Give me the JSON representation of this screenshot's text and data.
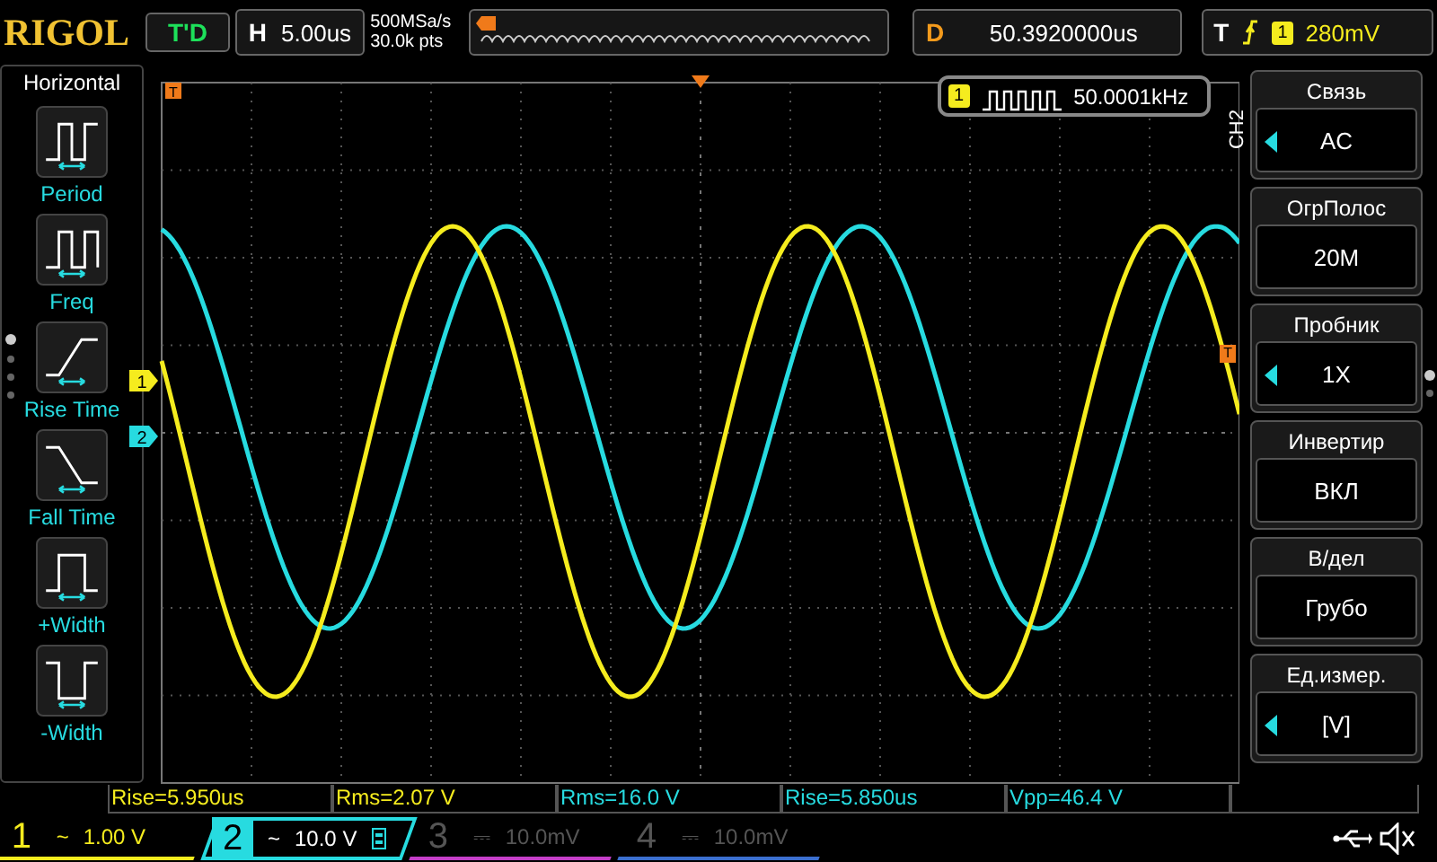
{
  "top_bar": {
    "logo": "RIGOL",
    "run_status": "T'D",
    "horizontal": {
      "label": "H",
      "value": "5.00us"
    },
    "sample_rate": "500MSa/s",
    "memory_depth": "30.0k pts",
    "delay": {
      "label": "D",
      "value": "50.3920000us"
    },
    "trigger": {
      "label": "T",
      "source": "1",
      "level": "280mV"
    }
  },
  "left_menu": {
    "title": "Horizontal",
    "items": [
      {
        "kind": "period",
        "label": "Period"
      },
      {
        "kind": "freq",
        "label": "Freq"
      },
      {
        "kind": "rise",
        "label": "Rise Time"
      },
      {
        "kind": "fall",
        "label": "Fall Time"
      },
      {
        "kind": "pwidth",
        "label": "+Width"
      },
      {
        "kind": "nwidth",
        "label": "-Width"
      }
    ]
  },
  "scope": {
    "counter": {
      "source": "1",
      "value": "50.0001kHz"
    },
    "top_marker": "T",
    "trigger_marker": "T",
    "markers": [
      {
        "label": "1",
        "color": "#f5ec1e"
      },
      {
        "label": "2",
        "color": "#27dbe0"
      }
    ]
  },
  "right_menu": {
    "channel": "CH2",
    "items": [
      {
        "title": "Связь",
        "value": "AC",
        "kind": "list"
      },
      {
        "title": "ОгрПолос",
        "value": "20M",
        "kind": "toggle"
      },
      {
        "title": "Пробник",
        "value": "1X",
        "kind": "list"
      },
      {
        "title": "Инвертир",
        "value": "ВКЛ",
        "kind": "toggle"
      },
      {
        "title": "В/дел",
        "value": "Грубо",
        "kind": "toggle"
      },
      {
        "title": "Ед.измер.",
        "value": "[V]",
        "kind": "list"
      }
    ]
  },
  "measurements": [
    {
      "text": "Rise=5.950us",
      "color": "#f5ec1e"
    },
    {
      "text": "Rms=2.07 V",
      "color": "#f5ec1e"
    },
    {
      "text": "Rms=16.0 V",
      "color": "#27dbe0"
    },
    {
      "text": "Rise=5.850us",
      "color": "#27dbe0"
    },
    {
      "text": "Vpp=46.4 V",
      "color": "#27dbe0"
    }
  ],
  "channels": [
    {
      "number": "1",
      "coupling": "~",
      "scale": "1.00 V",
      "color": "#f5ec1e",
      "on": true,
      "selected": false
    },
    {
      "number": "2",
      "coupling": "~",
      "scale": "10.0 V",
      "color": "#27dbe0",
      "on": true,
      "selected": true
    },
    {
      "number": "3",
      "coupling": "⎓",
      "scale": "10.0mV",
      "color": "#c43ec8",
      "on": false,
      "selected": false
    },
    {
      "number": "4",
      "coupling": "⎓",
      "scale": "10.0mV",
      "color": "#3b6fd0",
      "on": false,
      "selected": false
    }
  ]
}
